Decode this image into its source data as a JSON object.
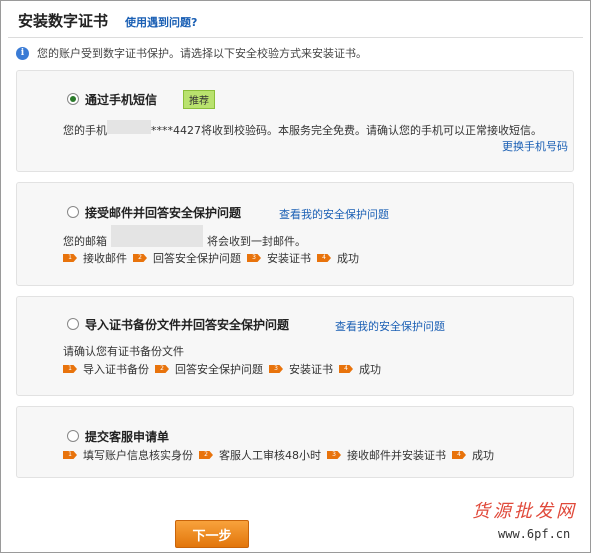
{
  "header": {
    "title": "安装数字证书",
    "help_link": "使用遇到问题?"
  },
  "info": {
    "text": "您的账户受到数字证书保护。请选择以下安全校验方式来安装证书。"
  },
  "options": [
    {
      "title": "通过手机短信",
      "badge": "推荐",
      "selected": true,
      "desc_prefix": "您的手机",
      "desc_suffix": "****4427将收到校验码。本服务完全免费。请确认您的手机可以正常接收短信。",
      "link": "更换手机号码"
    },
    {
      "title": "接受邮件并回答安全保护问题",
      "link": "查看我的安全保护问题",
      "selected": false,
      "desc_prefix": "您的邮箱",
      "desc_suffix": "将会收到一封邮件。",
      "steps": [
        "接收邮件",
        "回答安全保护问题",
        "安装证书",
        "成功"
      ]
    },
    {
      "title": "导入证书备份文件并回答安全保护问题",
      "link": "查看我的安全保护问题",
      "selected": false,
      "desc": "请确认您有证书备份文件",
      "steps": [
        "导入证书备份",
        "回答安全保护问题",
        "安装证书",
        "成功"
      ]
    },
    {
      "title": "提交客服申请单",
      "selected": false,
      "steps": [
        "填写账户信息核实身份",
        "客服人工审核48小时",
        "接收邮件并安装证书",
        "成功"
      ]
    }
  ],
  "next_button": "下一步",
  "watermark": {
    "text": "货源批发网",
    "url": "www.6pf.cn"
  },
  "colors": {
    "link": "#1a5fb4",
    "step_badge": "#e8730c",
    "button": "#f28c1e",
    "badge_bg": "#b9e26e"
  }
}
